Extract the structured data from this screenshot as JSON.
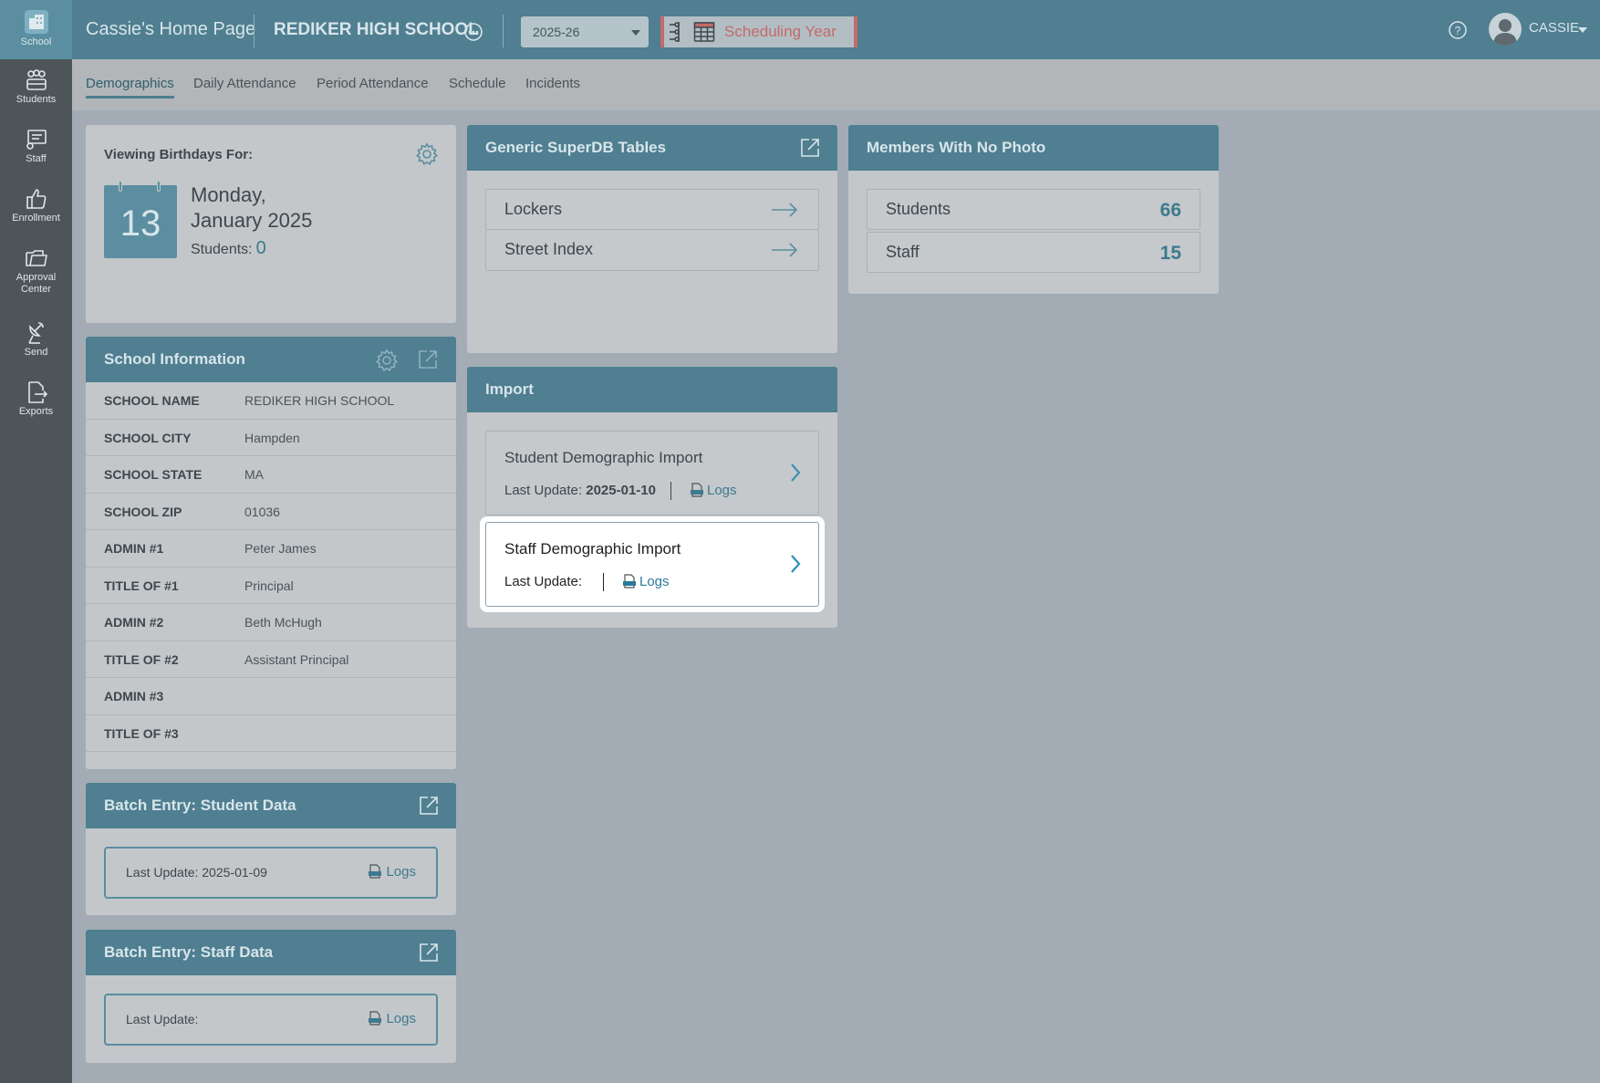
{
  "sidebar": {
    "items": [
      {
        "label": "School",
        "icon": "school-icon"
      },
      {
        "label": "Students",
        "icon": "students-icon"
      },
      {
        "label": "Staff",
        "icon": "staff-icon"
      },
      {
        "label": "Enrollment",
        "icon": "thumbs-up-icon"
      },
      {
        "label": "Approval Center",
        "icon": "folder-icon"
      },
      {
        "label": "Send",
        "icon": "satellite-icon"
      },
      {
        "label": "Exports",
        "icon": "export-file-icon"
      }
    ]
  },
  "header": {
    "home_title": "Cassie's Home Page",
    "school_name": "REDIKER HIGH SCHOOL",
    "year": "2025-26",
    "mode": "Scheduling Year",
    "user": "CASSIE"
  },
  "subnav": {
    "tabs": [
      "Demographics",
      "Daily Attendance",
      "Period Attendance",
      "Schedule",
      "Incidents"
    ],
    "active": "Demographics"
  },
  "birthdays": {
    "label": "Viewing Birthdays For:",
    "day": "13",
    "weekday": "Monday,",
    "month_year": "January 2025",
    "students_label": "Students:",
    "students_count": "0"
  },
  "school_info": {
    "title": "School Information",
    "rows": [
      {
        "key": "SCHOOL NAME",
        "value": "REDIKER HIGH SCHOOL"
      },
      {
        "key": "SCHOOL CITY",
        "value": "Hampden"
      },
      {
        "key": "SCHOOL STATE",
        "value": "MA"
      },
      {
        "key": "SCHOOL ZIP",
        "value": "01036"
      },
      {
        "key": "ADMIN #1",
        "value": "Peter James"
      },
      {
        "key": "TITLE OF #1",
        "value": "Principal"
      },
      {
        "key": "ADMIN #2",
        "value": "Beth McHugh"
      },
      {
        "key": "TITLE OF #2",
        "value": "Assistant Principal"
      },
      {
        "key": "ADMIN #3",
        "value": ""
      },
      {
        "key": "TITLE OF #3",
        "value": ""
      }
    ]
  },
  "superdb": {
    "title": "Generic SuperDB Tables",
    "items": [
      "Lockers",
      "Street Index"
    ]
  },
  "no_photo": {
    "title": "Members With No Photo",
    "rows": [
      {
        "label": "Students",
        "count": "66"
      },
      {
        "label": "Staff",
        "count": "15"
      }
    ]
  },
  "import": {
    "title": "Import",
    "items": [
      {
        "title": "Student Demographic Import",
        "last_label": "Last Update:",
        "last_value": "2025-01-10",
        "logs": "Logs"
      },
      {
        "title": "Staff Demographic Import",
        "last_label": "Last Update:",
        "last_value": "",
        "logs": "Logs"
      }
    ]
  },
  "batch_student": {
    "title": "Batch Entry: Student Data",
    "last": "Last Update: 2025-01-09",
    "logs": "Logs"
  },
  "batch_staff": {
    "title": "Batch Entry: Staff Data",
    "last": "Last Update:",
    "logs": "Logs"
  },
  "colors": {
    "accent": "#4f7f91",
    "rail": "#4e5559",
    "highlight_red": "#c46a6a",
    "link": "#3c7a8f"
  }
}
